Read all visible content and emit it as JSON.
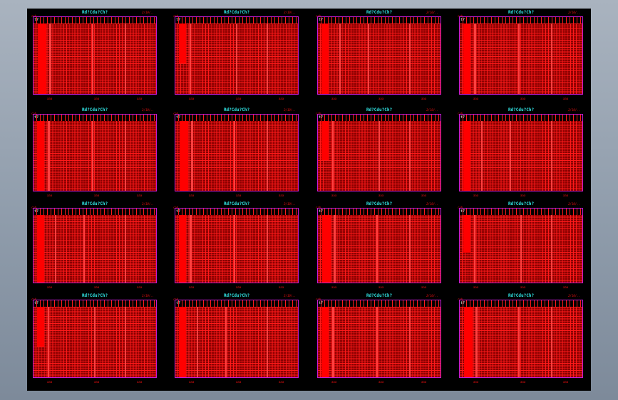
{
  "viewer": {
    "background": "#8f9cab",
    "drawing_background": "#000000",
    "grid_color": "#ff1a1a",
    "title_color": "#31e6e6",
    "frame_color": "#c41cd6"
  },
  "sheets": [
    {
      "title": "Rd?Cdu?Ch?",
      "date": "2/10/..",
      "corner": "t?",
      "foot": [
        "aaa",
        "aaa",
        "aaa"
      ],
      "mark": "cab"
    },
    {
      "title": "Rd?Cdu?Ch?",
      "date": "2/10/..",
      "corner": "t?",
      "foot": [
        "aaa",
        "aaa",
        "aaa"
      ],
      "mark": "cab"
    },
    {
      "title": "Rd?Cdu?Ch?",
      "date": "2/10/..",
      "corner": "t?",
      "foot": [
        "aaa",
        "aaa",
        "aaa"
      ],
      "mark": "cab"
    },
    {
      "title": "Rd?Cdu?Ch?",
      "date": "2/10/..",
      "corner": "t?",
      "foot": [
        "aaa",
        "aaa",
        "aaa"
      ],
      "mark": "cab"
    },
    {
      "title": "Rd?Cdu?Ch?",
      "date": "2/10/..",
      "corner": "t?",
      "foot": [
        "aaa",
        "aaa",
        "aaa"
      ],
      "mark": "cab"
    },
    {
      "title": "Rd?Cdu?Ch?",
      "date": "2/10/..",
      "corner": "t?",
      "foot": [
        "aaa",
        "aaa",
        "aaa"
      ],
      "mark": "cab"
    },
    {
      "title": "Rd?Cdu?Ch?",
      "date": "2/10/..",
      "corner": "t?",
      "foot": [
        "aaa",
        "aaa",
        "aaa"
      ],
      "mark": "cab"
    },
    {
      "title": "Rd?Cdu?Ch?",
      "date": "2/10/..",
      "corner": "t?",
      "foot": [
        "aaa",
        "aaa",
        "aaa"
      ],
      "mark": "cab"
    },
    {
      "title": "Rd?Cdu?Ch?",
      "date": "2/10/..",
      "corner": "t?",
      "foot": [
        "aaa",
        "aaa",
        "aaa"
      ],
      "mark": "cab"
    },
    {
      "title": "Rd?Cdu?Ch?",
      "date": "2/10/..",
      "corner": "t?",
      "foot": [
        "aaa",
        "aaa",
        "aaa"
      ],
      "mark": "cab"
    },
    {
      "title": "Rd?Cdu?Ch?",
      "date": "2/10/..",
      "corner": "t?",
      "foot": [
        "aaa",
        "aaa",
        "aaa"
      ],
      "mark": "cab"
    },
    {
      "title": "Rd?Cdu?Ch?",
      "date": "2/10/..",
      "corner": "t?",
      "foot": [
        "aaa",
        "aaa",
        "aaa"
      ],
      "mark": "cab"
    },
    {
      "title": "Rd?Cdu?Ch?",
      "date": "2/10/..",
      "corner": "t?",
      "foot": [
        "aaa",
        "aaa",
        "aaa"
      ],
      "mark": "cab"
    },
    {
      "title": "Rd?Cdu?Ch?",
      "date": "2/10/..",
      "corner": "t?",
      "foot": [
        "aaa",
        "aaa",
        "aaa"
      ],
      "mark": "cab"
    },
    {
      "title": "Rd?Cdu?Ch?",
      "date": "2/10/..",
      "corner": "t?",
      "foot": [
        "aaa",
        "aaa",
        "aaa"
      ],
      "mark": "cab"
    },
    {
      "title": "Rd?Cdu?Ch?",
      "date": "2/10/..",
      "corner": "t?",
      "foot": [
        "aaa",
        "aaa",
        "aaa"
      ],
      "mark": "cab"
    }
  ]
}
